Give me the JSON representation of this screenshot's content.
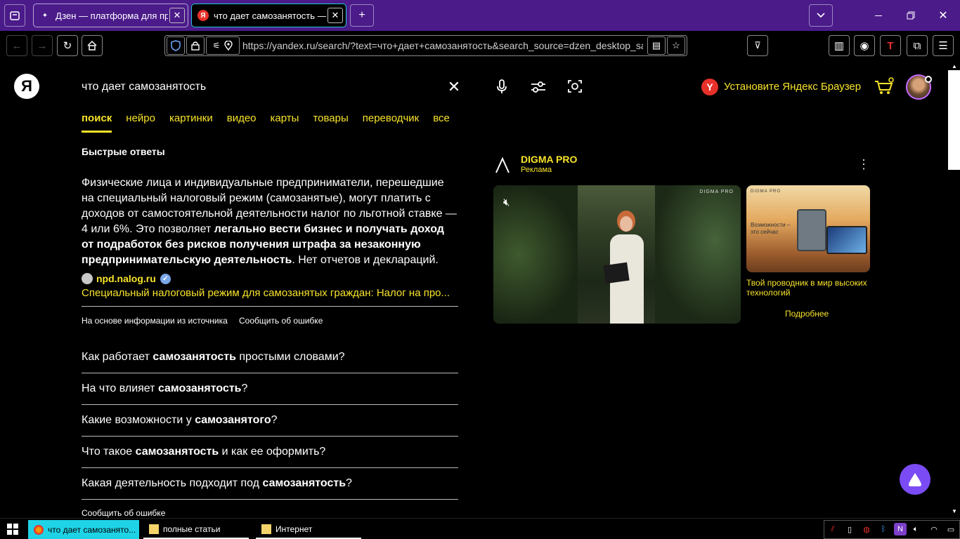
{
  "browser": {
    "tabs": [
      {
        "title": "Дзен — платформа для прос"
      },
      {
        "title": "что дает самозанятость — Ян"
      }
    ],
    "new_tab_label": "+",
    "url": "https://yandex.ru/search/?text=что+дает+самозанятость&search_source=dzen_desktop_safe"
  },
  "search": {
    "logo": "Я",
    "query": "что дает самозанятость",
    "install_browser": "Установите Яндекс Браузер",
    "tabs": [
      "поиск",
      "нейро",
      "картинки",
      "видео",
      "карты",
      "товары",
      "переводчик",
      "все"
    ]
  },
  "quick_answer": {
    "title": "Быстрые ответы",
    "text_part1": "Физические лица и индивидуальные предприниматели, перешедшие на специальный налоговый режим (самозанятые), могут платить с доходов от самостоятельной деятельности налог по льготной ставке — 4 или 6%. Это позволяет ",
    "text_bold": "легально вести бизнес и получать доход от подработок без рисков получения штрафа за незаконную предпринимательскую деятельность",
    "text_part2": ". Нет отчетов и деклараций.",
    "source_domain": "npd.nalog.ru",
    "source_title": "Специальный налоговый режим для самозанятых граждан: Налог на про...",
    "based_on": "На основе информации из источника",
    "report": "Сообщить об ошибке"
  },
  "faq": [
    {
      "pre": "Как работает ",
      "bold": "самозанятость",
      "post": " простыми словами?"
    },
    {
      "pre": "На что влияет ",
      "bold": "самозанятость",
      "post": "?"
    },
    {
      "pre": "Какие возможности у ",
      "bold": "самозанятого",
      "post": "?"
    },
    {
      "pre": "Что такое ",
      "bold": "самозанятость",
      "post": " и как ее оформить?"
    },
    {
      "pre": "Какая деятельность подходит под ",
      "bold": "самозанятость",
      "post": "?"
    }
  ],
  "faq_report": "Сообщить об ошибке",
  "ad": {
    "brand": "DIGMA PRO",
    "label": "Реклама",
    "video_watermark": "DIGMA PRO",
    "banner_watermark": "DIGMA PRO",
    "banner_caption": "Возможности – это сейчас",
    "text": "Твой проводник в мир высоких технологий",
    "more": "Подробнее"
  },
  "taskbar": {
    "items": [
      "что дает самозанято...",
      "полные статьи",
      "Интернет"
    ]
  },
  "colors": {
    "accent": "#f7e32b",
    "tabbar": "#4b1b8a",
    "active_tab_border": "#20c8d8",
    "alice": "#7b4cf5"
  }
}
